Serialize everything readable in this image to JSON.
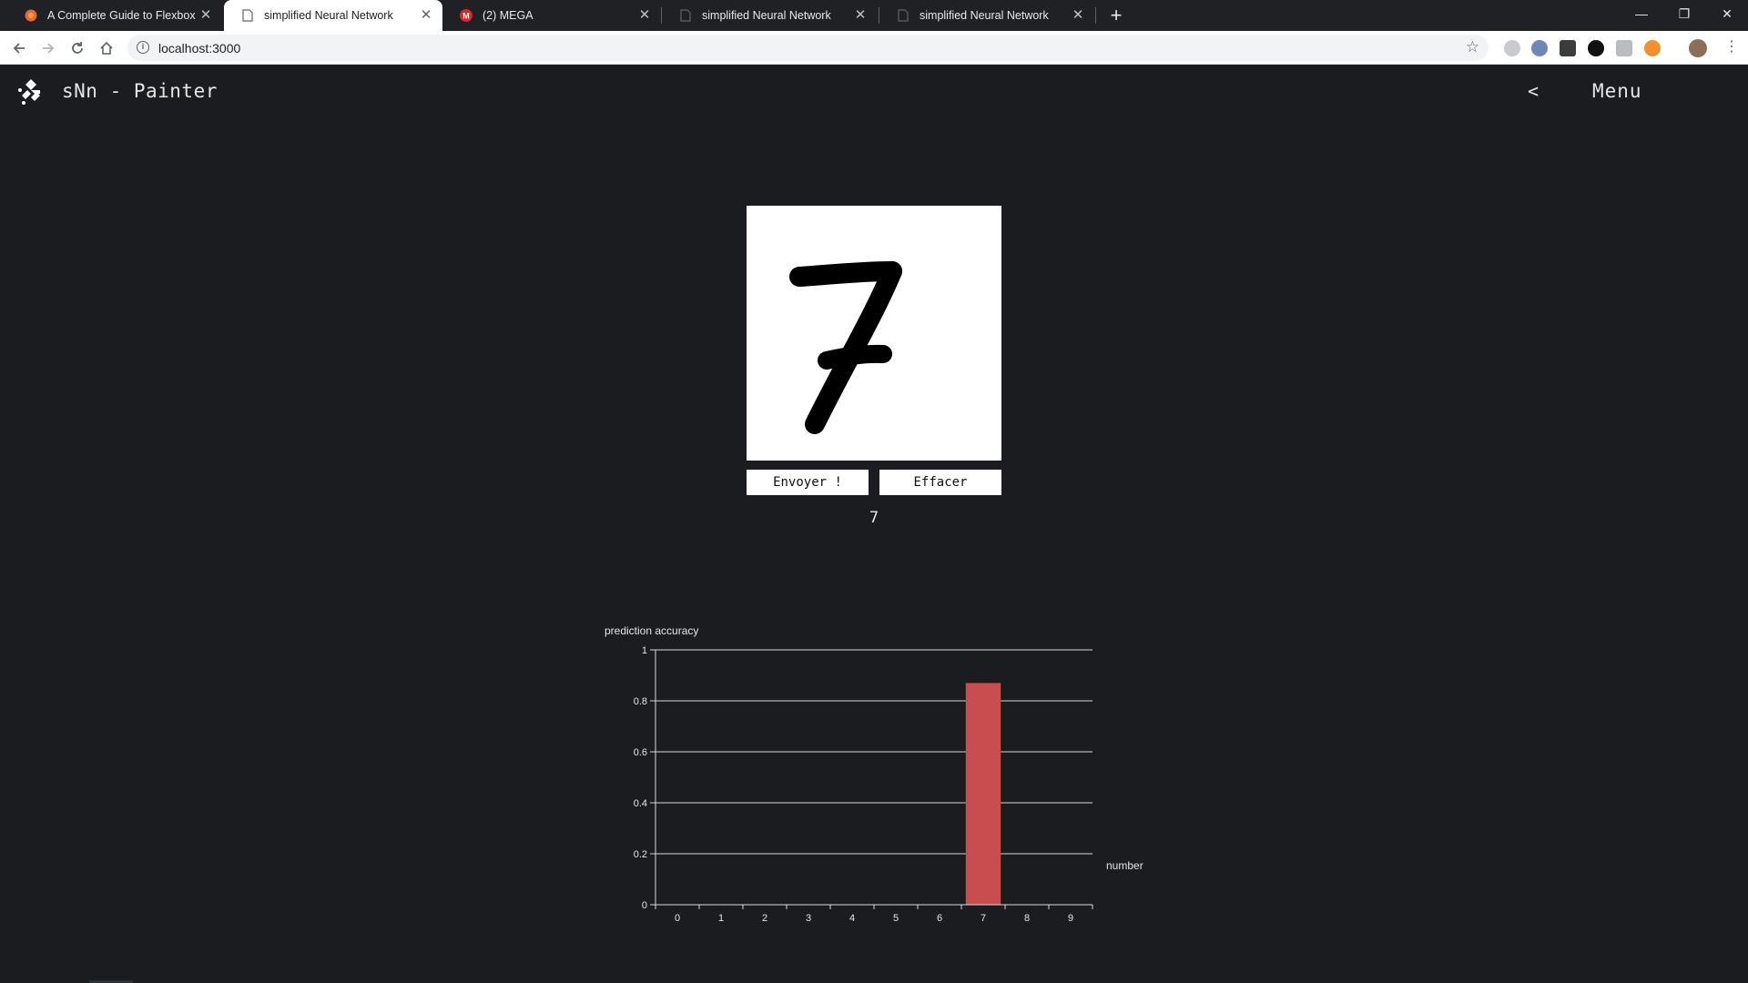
{
  "browser": {
    "tabs": [
      {
        "title": "A Complete Guide to Flexbox | C",
        "favicon": "css-tricks-icon",
        "active": false
      },
      {
        "title": "simplified Neural Network",
        "favicon": "page-icon",
        "active": true
      },
      {
        "title": "(2) MEGA",
        "favicon": "mega-icon",
        "active": false
      },
      {
        "title": "simplified Neural Network",
        "favicon": "page-icon",
        "active": false
      },
      {
        "title": "simplified Neural Network",
        "favicon": "page-icon",
        "active": false
      }
    ],
    "close_glyph": "✕",
    "new_tab_glyph": "+",
    "url": "localhost:3000",
    "window_controls": {
      "minimize": "—",
      "restore": "❐",
      "close": "✕"
    }
  },
  "app": {
    "title": "sNn - Painter",
    "menu_toggle": "<",
    "menu_label": "Menu"
  },
  "painter": {
    "drawn_digit": "7",
    "send_label": "Envoyer !",
    "clear_label": "Effacer",
    "prediction": "7"
  },
  "colors": {
    "background": "#1a1c1f",
    "bar": "#c94c4f",
    "text": "#e6e6e6"
  },
  "chart_data": {
    "type": "bar",
    "ylabel": "prediction accuracy",
    "xlabel": "number",
    "categories": [
      "0",
      "1",
      "2",
      "3",
      "4",
      "5",
      "6",
      "7",
      "8",
      "9"
    ],
    "values": [
      0,
      0,
      0,
      0,
      0,
      0,
      0,
      0.87,
      0,
      0
    ],
    "ylim": [
      0,
      1
    ],
    "yticks": [
      "0",
      "0.2",
      "0.4",
      "0.6",
      "0.8",
      "1"
    ],
    "grid": true
  }
}
